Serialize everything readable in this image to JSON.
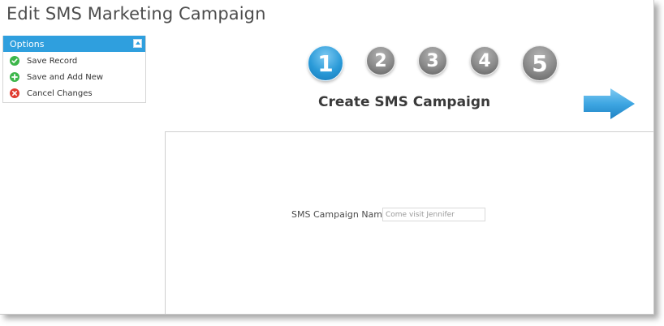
{
  "page": {
    "title": "Edit SMS Marketing Campaign"
  },
  "options": {
    "header": "Options",
    "items": [
      {
        "label": "Save Record",
        "icon": "check-circle-icon",
        "color": "#3cb64a"
      },
      {
        "label": "Save and Add New",
        "icon": "plus-circle-icon",
        "color": "#3cb64a"
      },
      {
        "label": "Cancel Changes",
        "icon": "x-circle-icon",
        "color": "#e03c31"
      }
    ]
  },
  "wizard": {
    "steps": [
      "1",
      "2",
      "3",
      "4",
      "5"
    ],
    "active_step": 1,
    "step_title": "Create SMS Campaign",
    "active_color": "#2a9ad8",
    "inactive_color": "#8a8a8a",
    "next_icon": "arrow-right-icon"
  },
  "form": {
    "campaign_name_label": "SMS Campaign Name",
    "campaign_name_value": "Come visit Jennifer"
  }
}
